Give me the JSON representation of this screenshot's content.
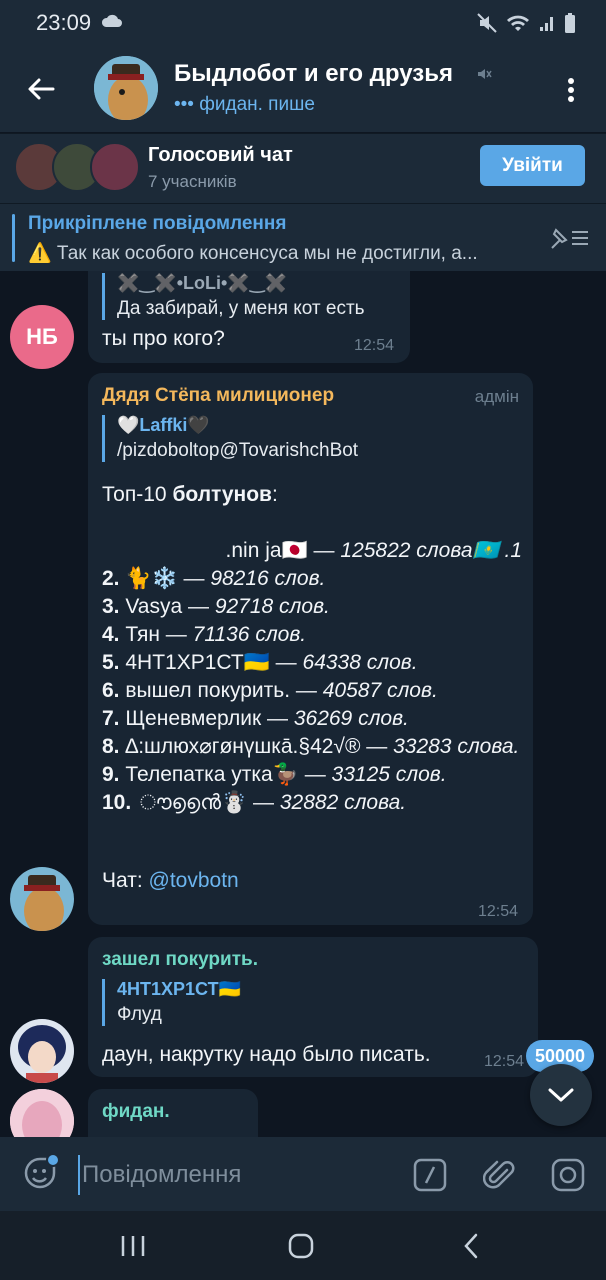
{
  "statusbar": {
    "time": "23:09"
  },
  "header": {
    "title": "Быдлобот и его друзья",
    "status": "••• фидан. пише"
  },
  "voice_chat": {
    "title": "Голосовий чат",
    "participants": "7 учасників",
    "join_label": "Увійти"
  },
  "pinned": {
    "title": "Прикріплене повідомлення",
    "text": "⚠️ Так как особого консенсуса мы не достигли, а..."
  },
  "messages": {
    "m1": {
      "avatar_initials": "НБ",
      "reply_name": "✖️‿✖️•LoLi•✖️‿✖️",
      "reply_text": "Да забирай, у меня кот есть",
      "text": "ты про кого?",
      "time": "12:54"
    },
    "m2": {
      "sender": "Дядя Стёпа милиционер",
      "role": "адмін",
      "reply_name": "🤍Laffki🖤",
      "reply_text": "/pizdoboltop@TovarishchBot",
      "heading_prefix": "Топ-10 ",
      "heading_bold": "болтунов",
      "heading_suffix": ":",
      "rows": [
        {
          "num": "",
          "name": ".nin ja🇯🇵 — ",
          "count": "125822 слова🇰🇿 .1"
        },
        {
          "num": "2.",
          "name": " 🐈❄️ — ",
          "count": "98216 слов."
        },
        {
          "num": "3.",
          "name": " Vasya — ",
          "count": "92718 слов."
        },
        {
          "num": "4.",
          "name": " Тян — ",
          "count": "71136 слов."
        },
        {
          "num": "5.",
          "name": " 4НТ1ХР1СТ🇺🇦 — ",
          "count": "64338 слов."
        },
        {
          "num": "6.",
          "name": " вышел покурить. — ",
          "count": "40587 слов."
        },
        {
          "num": "7.",
          "name": " Щеневмерлик — ",
          "count": "36269 слов."
        },
        {
          "num": "8.",
          "name": " ∆:шлюх⌀гøнүшка̄.§42√® — ",
          "count": "33283 слова."
        },
        {
          "num": "9.",
          "name": " Телепатка утка🦆 — ",
          "count": "33125 слов."
        },
        {
          "num": "10.",
          "name": " ൗ൭൭ൻ☃️ — ",
          "count": "32882 слова."
        }
      ],
      "chat_label": "Чат: ",
      "chat_link": "@tovbotn",
      "time": "12:54"
    },
    "m3": {
      "sender": "зашел покурить.",
      "reply_name": "4НТ1ХР1СТ🇺🇦",
      "reply_text": "Флуд",
      "text": "даун, накрутку надо было писать.",
      "time": "12:54"
    },
    "m4": {
      "sender": "фидан."
    }
  },
  "unread_count": "50000",
  "composer": {
    "placeholder": "Повідомлення"
  },
  "colors": {
    "accent": "#5aa7e6",
    "background": "#0e1621",
    "bubble": "#182533",
    "admin_name": "#f4b85c",
    "green_name": "#6fd8c5",
    "avatar_nb": "#ea6a8a"
  }
}
